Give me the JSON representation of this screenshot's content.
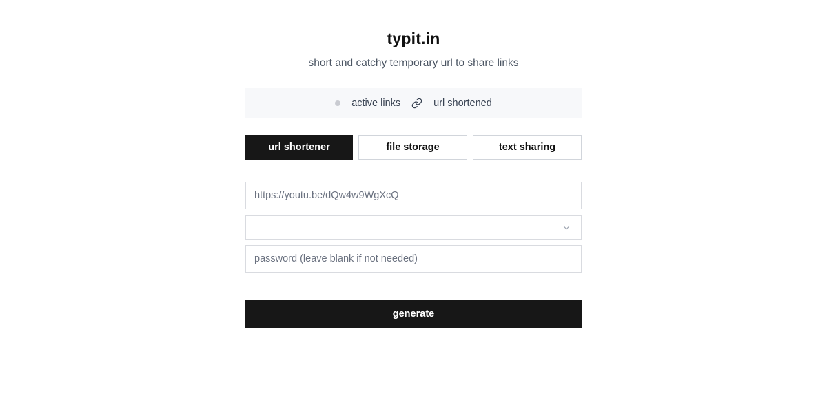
{
  "header": {
    "title": "typit.in",
    "subtitle": "short and catchy temporary url to share links"
  },
  "stats": {
    "active_links": "active links",
    "url_shortened": "url shortened",
    "icons": [
      "status-dot",
      "link-icon"
    ]
  },
  "tabs": [
    {
      "label": "url shortener",
      "active": true
    },
    {
      "label": "file storage",
      "active": false
    },
    {
      "label": "text sharing",
      "active": false
    }
  ],
  "form": {
    "url_placeholder": "https://youtu.be/dQw4w9WgXcQ",
    "url_value": "",
    "expiry_selected": "",
    "password_placeholder": "password (leave blank if not needed)",
    "password_value": ""
  },
  "actions": {
    "generate_label": "generate"
  },
  "colors": {
    "primary": "#171717",
    "background": "#ffffff",
    "stats_bg": "#f7f8fa",
    "border": "#d9dbe0",
    "muted_text": "#4b5563"
  }
}
